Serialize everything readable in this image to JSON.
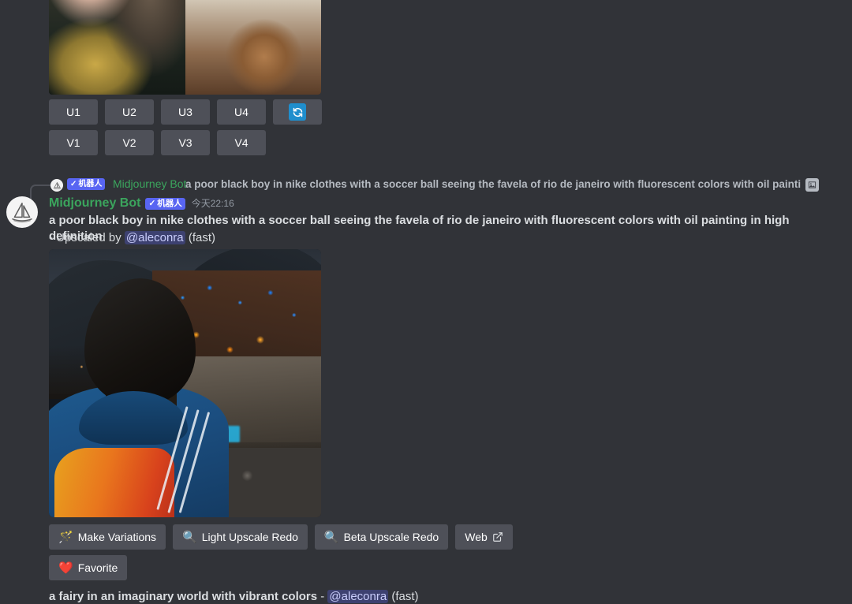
{
  "theme": {
    "background": "#313338",
    "button_bg": "#4e5058",
    "accent_blurple": "#5865f2",
    "bot_name_green": "#3ba55d",
    "refresh_blue": "#1f8ecd",
    "muted_text": "#949ba4",
    "body_text": "#dbdee1"
  },
  "top_message": {
    "image_alt": "midjourney 2x2 grid result",
    "upscale_buttons": [
      {
        "label": "U1",
        "name": "upscale-1-button"
      },
      {
        "label": "U2",
        "name": "upscale-2-button"
      },
      {
        "label": "U3",
        "name": "upscale-3-button"
      },
      {
        "label": "U4",
        "name": "upscale-4-button"
      }
    ],
    "reroll": {
      "icon": "refresh-icon",
      "label": ""
    },
    "variation_buttons": [
      {
        "label": "V1",
        "name": "variation-1-button"
      },
      {
        "label": "V2",
        "name": "variation-2-button"
      },
      {
        "label": "V3",
        "name": "variation-3-button"
      },
      {
        "label": "V4",
        "name": "variation-4-button"
      }
    ]
  },
  "reply_reference": {
    "author": "Midjourney Bot",
    "badge_label": "机器人",
    "badge_check": "✓",
    "preview_text": "a poor black boy in nike clothes with a soccer ball seeing the favela of rio de janeiro with fluorescent colors with oil painting in hig",
    "attachment_icon": "image-attachment-icon"
  },
  "main_message": {
    "author": "Midjourney Bot",
    "badge_label": "机器人",
    "badge_check": "✓",
    "timestamp": "今天22:16",
    "avatar_icon": "midjourney-sailboat-avatar",
    "prompt": "a poor black boy in nike clothes with a soccer ball seeing the favela of rio de janeiro with fluorescent colors with oil painting in high definition",
    "sub_prefix": "- Upscaled by ",
    "mention": "@aleconra",
    "sub_suffix": " (fast)",
    "image_alt": "upscaled image of a boy looking at a favela at night",
    "action_buttons": [
      {
        "label": "Make Variations",
        "icon": "magic-wand-icon",
        "glyph": "🪄",
        "name": "make-variations-button"
      },
      {
        "label": "Light Upscale Redo",
        "icon": "magnifier-icon",
        "glyph": "🔍",
        "name": "light-upscale-redo-button"
      },
      {
        "label": "Beta Upscale Redo",
        "icon": "magnifier-icon",
        "glyph": "🔍",
        "name": "beta-upscale-redo-button"
      },
      {
        "label": "Web",
        "icon": "external-link-icon",
        "glyph": "",
        "name": "web-button"
      }
    ],
    "favorite_button": {
      "label": "Favorite",
      "icon": "heart-icon",
      "glyph": "❤️",
      "name": "favorite-button"
    }
  },
  "next_message": {
    "prompt": "a fairy in an imaginary world with vibrant colors",
    "separator": " - ",
    "mention": "@aleconra",
    "suffix": " (fast)"
  }
}
